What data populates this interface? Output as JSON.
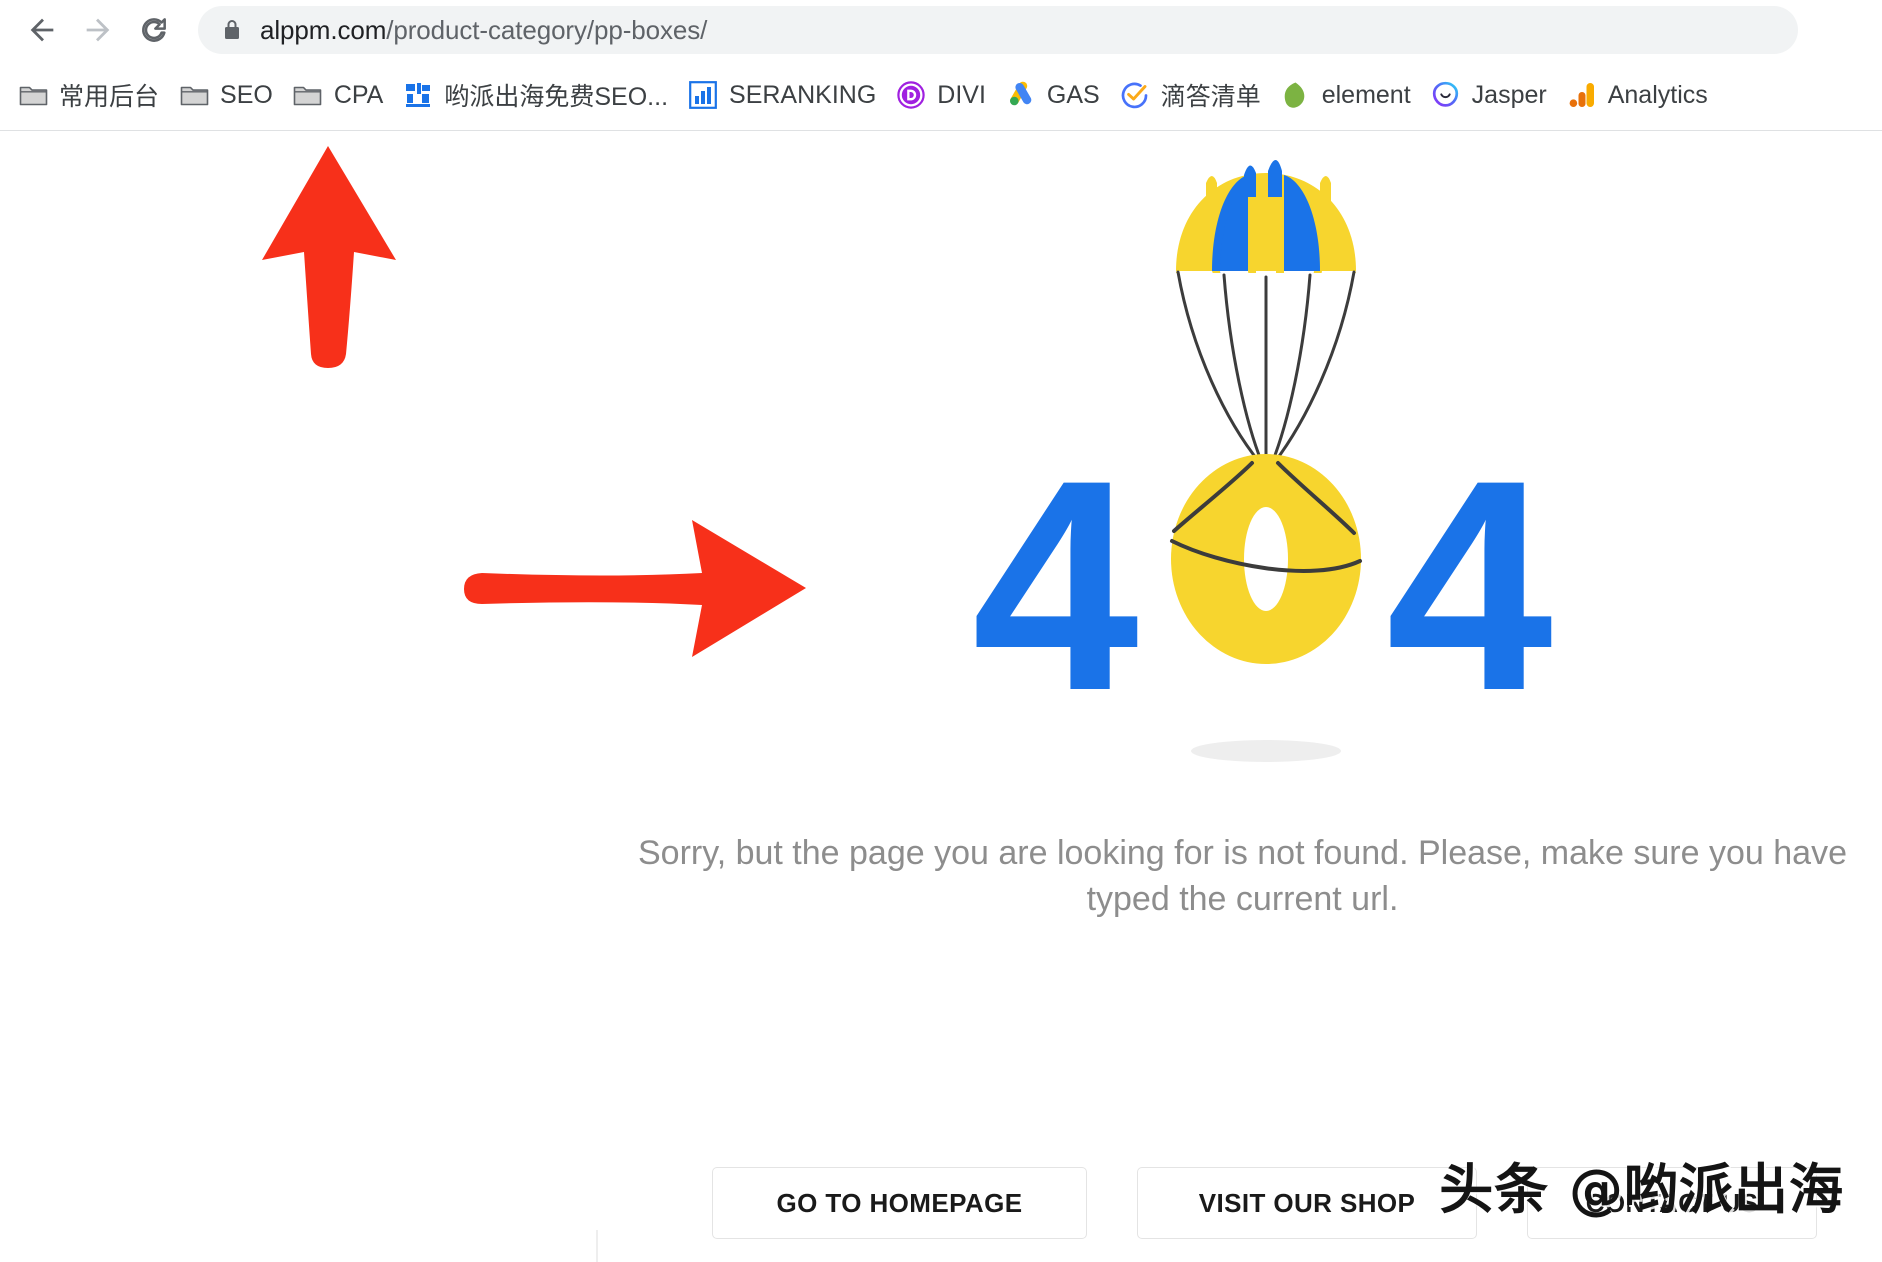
{
  "browser": {
    "nav": {
      "back_label": "Back",
      "forward_label": "Forward",
      "reload_label": "Reload"
    },
    "omnibox": {
      "lock_icon": "lock-icon",
      "url_host": "alppm.com",
      "url_path": "/product-category/pp-boxes/",
      "url_full": "alppm.com/product-category/pp-boxes/"
    },
    "bookmarks": [
      {
        "label": "常用后台",
        "icon": "folder-icon"
      },
      {
        "label": "SEO",
        "icon": "folder-icon"
      },
      {
        "label": "CPA",
        "icon": "folder-icon"
      },
      {
        "label": "哟派出海免费SEO...",
        "icon": "yopai-icon"
      },
      {
        "label": "SERANKING",
        "icon": "seranking-icon"
      },
      {
        "label": "DIVI",
        "icon": "divi-icon"
      },
      {
        "label": "GAS",
        "icon": "google-ads-icon"
      },
      {
        "label": "滴答清单",
        "icon": "ticktick-icon"
      },
      {
        "label": "element",
        "icon": "element-leaf-icon"
      },
      {
        "label": "Jasper",
        "icon": "jasper-icon"
      },
      {
        "label": "Analytics",
        "icon": "google-analytics-icon"
      }
    ]
  },
  "page": {
    "error_code": "404",
    "illustration_name": "parachute-404-illustration",
    "message": "Sorry, but the page you are looking for is not found. Please, make sure you have typed the current url.",
    "buttons": [
      {
        "label": "GO TO HOMEPAGE",
        "name": "go-to-homepage-button"
      },
      {
        "label": "VISIT OUR SHOP",
        "name": "visit-our-shop-button"
      },
      {
        "label": "CONTACT US",
        "name": "contact-us-button"
      }
    ]
  },
  "annotations": {
    "arrow_up": "red-up-arrow",
    "arrow_right": "red-right-arrow",
    "watermark": "头条 @哟派出海"
  },
  "colors": {
    "digit_blue": "#1a73e8",
    "parachute_yellow": "#f7d52e",
    "parachute_blue": "#1a73e8",
    "annotation_red": "#f7301a",
    "message_gray": "#8d8d8d",
    "omnibox_bg": "#f1f3f4"
  }
}
